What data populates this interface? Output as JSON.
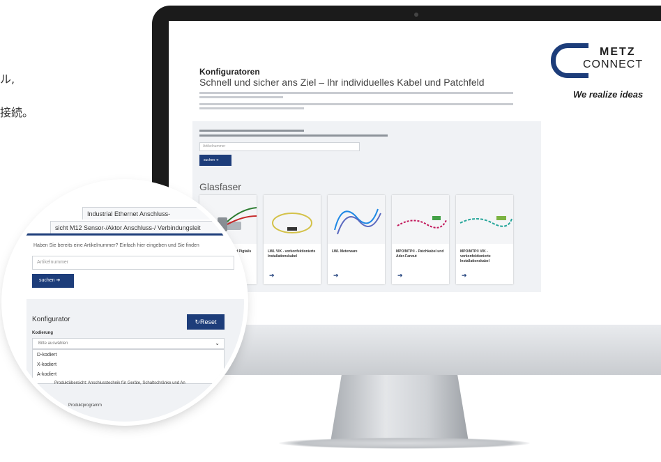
{
  "intro_text": {
    "line1": "ル,",
    "line2": "接続。"
  },
  "screen": {
    "logo": {
      "brand_top": "METZ",
      "brand_bottom": "CONNECT",
      "tagline": "We realize ideas"
    },
    "heading": "Konfiguratoren",
    "subheading": "Schnell und sicher ans Ziel – Ihr individuelles Kabel und Patchfeld",
    "search": {
      "placeholder": "Artikelnummer",
      "button": "suchen"
    },
    "section_title": "Glasfaser",
    "cards": [
      {
        "label": "LWL-Patchkabel und Pigtails"
      },
      {
        "label": "LWL VIK - vorkonfektionierte Installationskabel"
      },
      {
        "label": "LWL Meterware"
      },
      {
        "label": "MPO/MTP® - Patchkabel und Ader-Fanout"
      },
      {
        "label": "MPO/MTP® VIK - vorkonfektionierte Installationskabel"
      }
    ]
  },
  "zoom": {
    "tab1": "Industrial Ethernet Anschluss-",
    "tab2": "sicht M12 Sensor-/Aktor Anschluss-/ Verbindungsleit",
    "question": "Haben Sie bereits eine Artikelnummer? Einfach hier eingeben und Sie finden",
    "input_placeholder": "Artikelnummer",
    "button": "suchen",
    "konfigurator_label": "Konfigurator",
    "reset_label": "Reset",
    "kodierung_label": "Kodierung",
    "select_value": "Bitte auswählen",
    "options": [
      "D-kodiert",
      "X-kodiert",
      "A-kodiert"
    ],
    "produkt_text": "Produktübersicht: Anschlusstechnik für Geräte, Schaltschränke und An",
    "programm_text": "Produktprogramm"
  },
  "colors": {
    "accent": "#1d3d7a",
    "panel": "#f0f2f5"
  }
}
